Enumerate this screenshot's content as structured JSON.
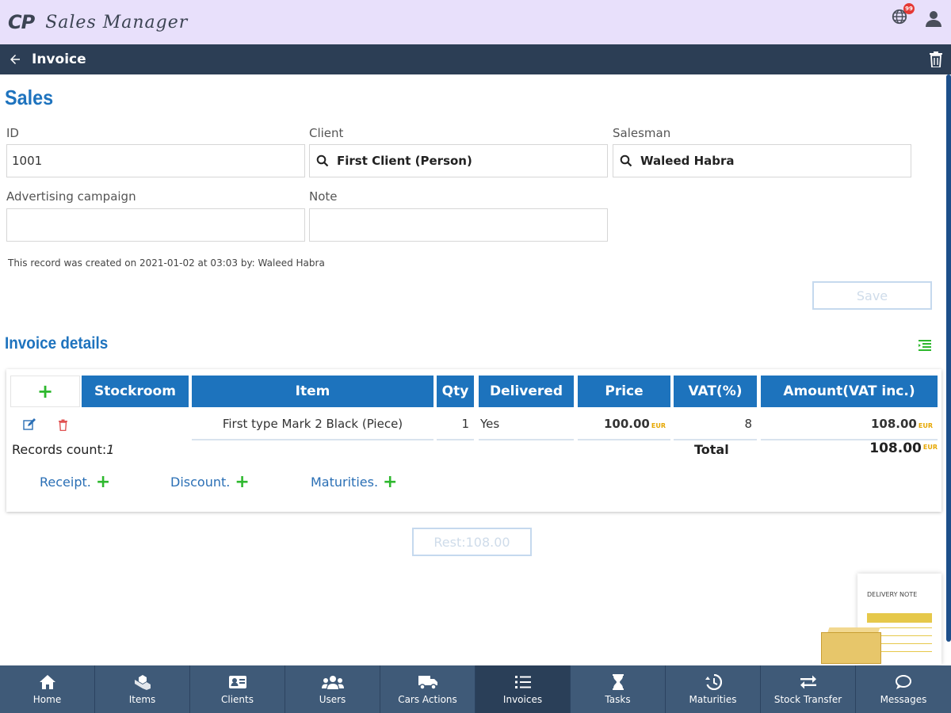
{
  "appbar": {
    "logo": "CP",
    "title": "Sales Manager",
    "notification_badge": "99"
  },
  "titlebar": {
    "title": "Invoice"
  },
  "sales": {
    "title": "Sales",
    "id_label": "ID",
    "id_value": "1001",
    "client_label": "Client",
    "client_value": "First Client (Person)",
    "salesman_label": "Salesman",
    "salesman_value": "Waleed Habra",
    "campaign_label": "Advertising campaign",
    "campaign_value": "",
    "note_label": "Note",
    "note_value": "",
    "record_info": "This record was created on 2021-01-02 at 03:03 by: Waleed Habra",
    "save_label": "Save"
  },
  "details": {
    "title": "Invoice details",
    "add_symbol": "+",
    "columns": [
      "Stockroom",
      "Item",
      "Qty",
      "Delivered",
      "Price",
      "VAT(%)",
      "Amount(VAT inc.)"
    ],
    "rows": [
      {
        "stockroom": "",
        "item": "First type Mark 2 Black (Piece)",
        "qty": "1",
        "delivered": "Yes",
        "price": "100.00",
        "vat": "8",
        "amount": "108.00"
      }
    ],
    "currency": "EUR",
    "records_count_label": "Records count:",
    "records_count_value": "1",
    "total_label": "Total",
    "total_value": "108.00",
    "receipt_label": "Receipt.",
    "discount_label": "Discount.",
    "maturities_label": "Maturities."
  },
  "rest_label": "Rest:108.00",
  "delivery_note_text": "DELIVERY NOTE",
  "bottomnav": {
    "items": [
      {
        "label": "Home",
        "icon": "home-icon"
      },
      {
        "label": "Items",
        "icon": "items-icon"
      },
      {
        "label": "Clients",
        "icon": "clients-icon"
      },
      {
        "label": "Users",
        "icon": "users-icon"
      },
      {
        "label": "Cars Actions",
        "icon": "truck-icon"
      },
      {
        "label": "Invoices",
        "icon": "invoices-icon"
      },
      {
        "label": "Tasks",
        "icon": "hourglass-icon"
      },
      {
        "label": "Maturities",
        "icon": "history-icon"
      },
      {
        "label": "Stock Transfer",
        "icon": "transfer-icon"
      },
      {
        "label": "Messages",
        "icon": "message-icon"
      }
    ],
    "active": "Invoices"
  },
  "colors": {
    "accent": "#1e73be",
    "appbar_bg": "#e8e0fb",
    "titlebar_bg": "#2c3e55",
    "nav_bg": "#3f5a78",
    "add_green": "#2eb82e",
    "currency_yellow": "#e6a700"
  }
}
